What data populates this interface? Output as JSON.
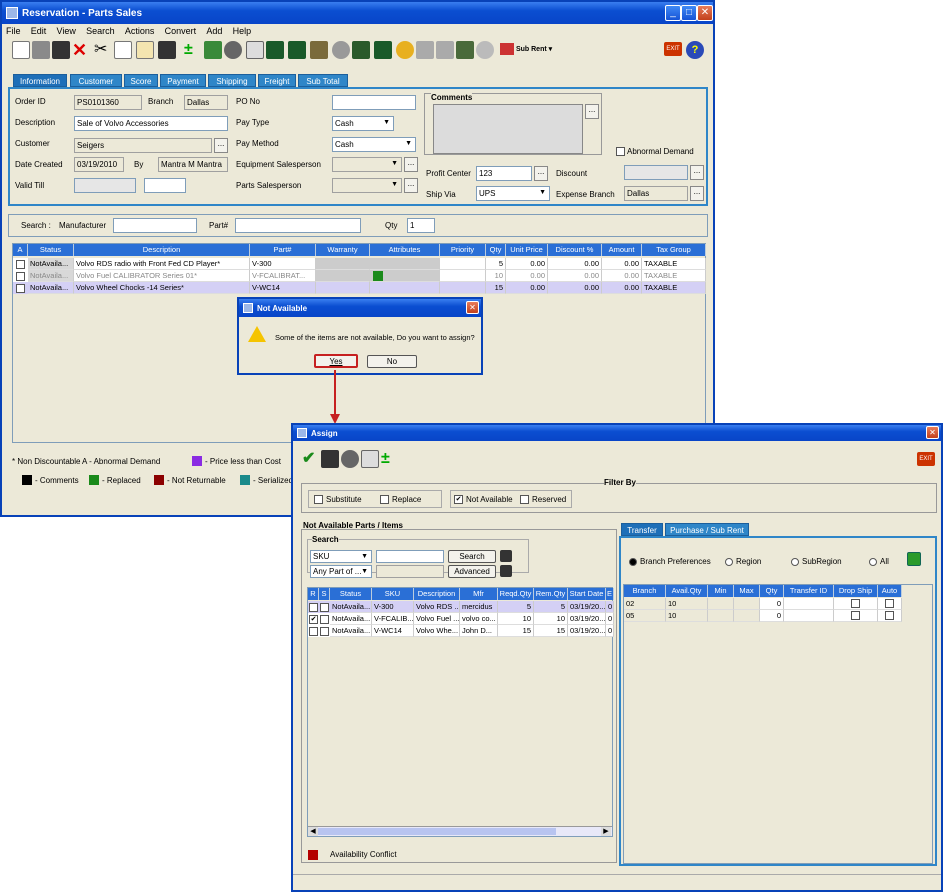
{
  "main": {
    "title": "Reservation - Parts Sales",
    "menu": [
      "File",
      "Edit",
      "View",
      "Search",
      "Actions",
      "Convert",
      "Add",
      "Help"
    ],
    "toolbar_sub_rent": "Sub Rent",
    "tabs": [
      "Information",
      "Customer",
      "Score",
      "Payment",
      "Shipping",
      "Freight",
      "Sub Total"
    ],
    "form": {
      "order_id_label": "Order ID",
      "order_id": "PS0101360",
      "branch_label": "Branch",
      "branch": "Dallas",
      "po_label": "PO No",
      "po": "",
      "description_label": "Description",
      "description": "Sale of Volvo Accessories",
      "pay_type_label": "Pay Type",
      "pay_type": "Cash",
      "customer_label": "Customer",
      "customer": "Seigers",
      "pay_method_label": "Pay Method",
      "pay_method": "Cash",
      "date_created_label": "Date Created",
      "date_created": "03/19/2010",
      "by_label": "By",
      "by": "Mantra M Mantra",
      "equipment_sp_label": "Equipment Salesperson",
      "valid_till_label": "Valid Till",
      "parts_sp_label": "Parts Salesperson",
      "comments_label": "Comments",
      "abnormal_label": "Abnormal Demand",
      "profit_center_label": "Profit Center",
      "profit_center": "123",
      "discount_label": "Discount",
      "ship_via_label": "Ship Via",
      "ship_via": "UPS",
      "expense_branch_label": "Expense Branch",
      "expense_branch": "Dallas"
    },
    "search": {
      "search_label": "Search :",
      "manufacturer_label": "Manufacturer",
      "part_label": "Part#",
      "qty_label": "Qty",
      "qty": "1"
    },
    "grid": {
      "headers": [
        "A",
        "Status",
        "Description",
        "Part#",
        "Warranty",
        "Attributes",
        "Priority",
        "Qty",
        "Unit Price",
        "Discount %",
        "Amount",
        "Tax Group"
      ],
      "rows": [
        {
          "status": "NotAvaila...",
          "description": "Volvo RDS radio with Front Fed CD Player*",
          "part": "V-300",
          "qty": "5",
          "unit_price": "0.00",
          "discount": "0.00",
          "amount": "0.00",
          "tax": "TAXABLE"
        },
        {
          "status": "NotAvaila...",
          "description": "Volvo Fuel CALIBRATOR Series 01*",
          "part": "V-FCALIBRAT...",
          "qty": "10",
          "unit_price": "0.00",
          "discount": "0.00",
          "amount": "0.00",
          "tax": "TAXABLE"
        },
        {
          "status": "NotAvaila...",
          "description": "Volvo Wheel Chocks -14 Series*",
          "part": "V-WC14",
          "qty": "15",
          "unit_price": "0.00",
          "discount": "0.00",
          "amount": "0.00",
          "tax": "TAXABLE"
        }
      ]
    },
    "legend": {
      "line1a": "* Non Discountable",
      "line1b": "A - Abnormal Demand",
      "line1c": "- Price less than Cost",
      "comments": "- Comments",
      "replaced": "- Replaced",
      "not_returnable": "- Not Returnable",
      "serialized": "- Serialized"
    }
  },
  "dialog": {
    "title": "Not Available",
    "message": "Some of the items are not available, Do you want to assign?",
    "yes": "Yes",
    "no": "No"
  },
  "assign": {
    "title": "Assign",
    "filter_by": "Filter By",
    "filters": [
      {
        "label": "Substitute",
        "checked": false
      },
      {
        "label": "Replace",
        "checked": false
      },
      {
        "label": "Not Available",
        "checked": true
      },
      {
        "label": "Reserved",
        "checked": false
      }
    ],
    "left_title": "Not Available Parts / Items",
    "search_title": "Search",
    "sku_option": "SKU",
    "any_part_option": "Any Part of ...",
    "search_btn": "Search",
    "advanced_btn": "Advanced",
    "headers": [
      "R",
      "S",
      "Status",
      "SKU",
      "Description",
      "Mfr",
      "Reqd.Qty",
      "Rem.Qty",
      "Start Date",
      "E"
    ],
    "rows": [
      {
        "r": false,
        "s": false,
        "status": "NotAvaila...",
        "sku": "V-300",
        "description": "Volvo RDS ...",
        "mfr": "mercidus",
        "reqd": "5",
        "rem": "5",
        "start": "03/19/20...",
        "e": "0"
      },
      {
        "r": true,
        "s": false,
        "status": "NotAvaila...",
        "sku": "V-FCALIB...",
        "description": "Volvo Fuel ...",
        "mfr": "volvo co...",
        "reqd": "10",
        "rem": "10",
        "start": "03/19/20...",
        "e": "0"
      },
      {
        "r": false,
        "s": false,
        "status": "NotAvaila...",
        "sku": "V-WC14",
        "description": "Volvo Whe...",
        "mfr": "John D...",
        "reqd": "15",
        "rem": "15",
        "start": "03/19/20...",
        "e": "0"
      }
    ],
    "conflict_label": "Availability Conflict",
    "right_tabs": [
      "Transfer",
      "Purchase / Sub Rent"
    ],
    "radios": [
      "Branch Preferences",
      "Region",
      "SubRegion",
      "All"
    ],
    "transfer_headers": [
      "Branch",
      "Avail.Qty",
      "Min",
      "Max",
      "Qty",
      "Transfer ID",
      "Drop Ship",
      "Auto"
    ],
    "transfer_rows": [
      {
        "branch": "02",
        "avail": "10",
        "qty": "0"
      },
      {
        "branch": "05",
        "avail": "10",
        "qty": "0"
      }
    ]
  },
  "colors": {
    "titlebar": "#0b4ed1",
    "header": "#2a6fd6",
    "tab": "#2f86c8",
    "selected_row": "#d4d0f5",
    "highlight": "#cc1f1f"
  }
}
